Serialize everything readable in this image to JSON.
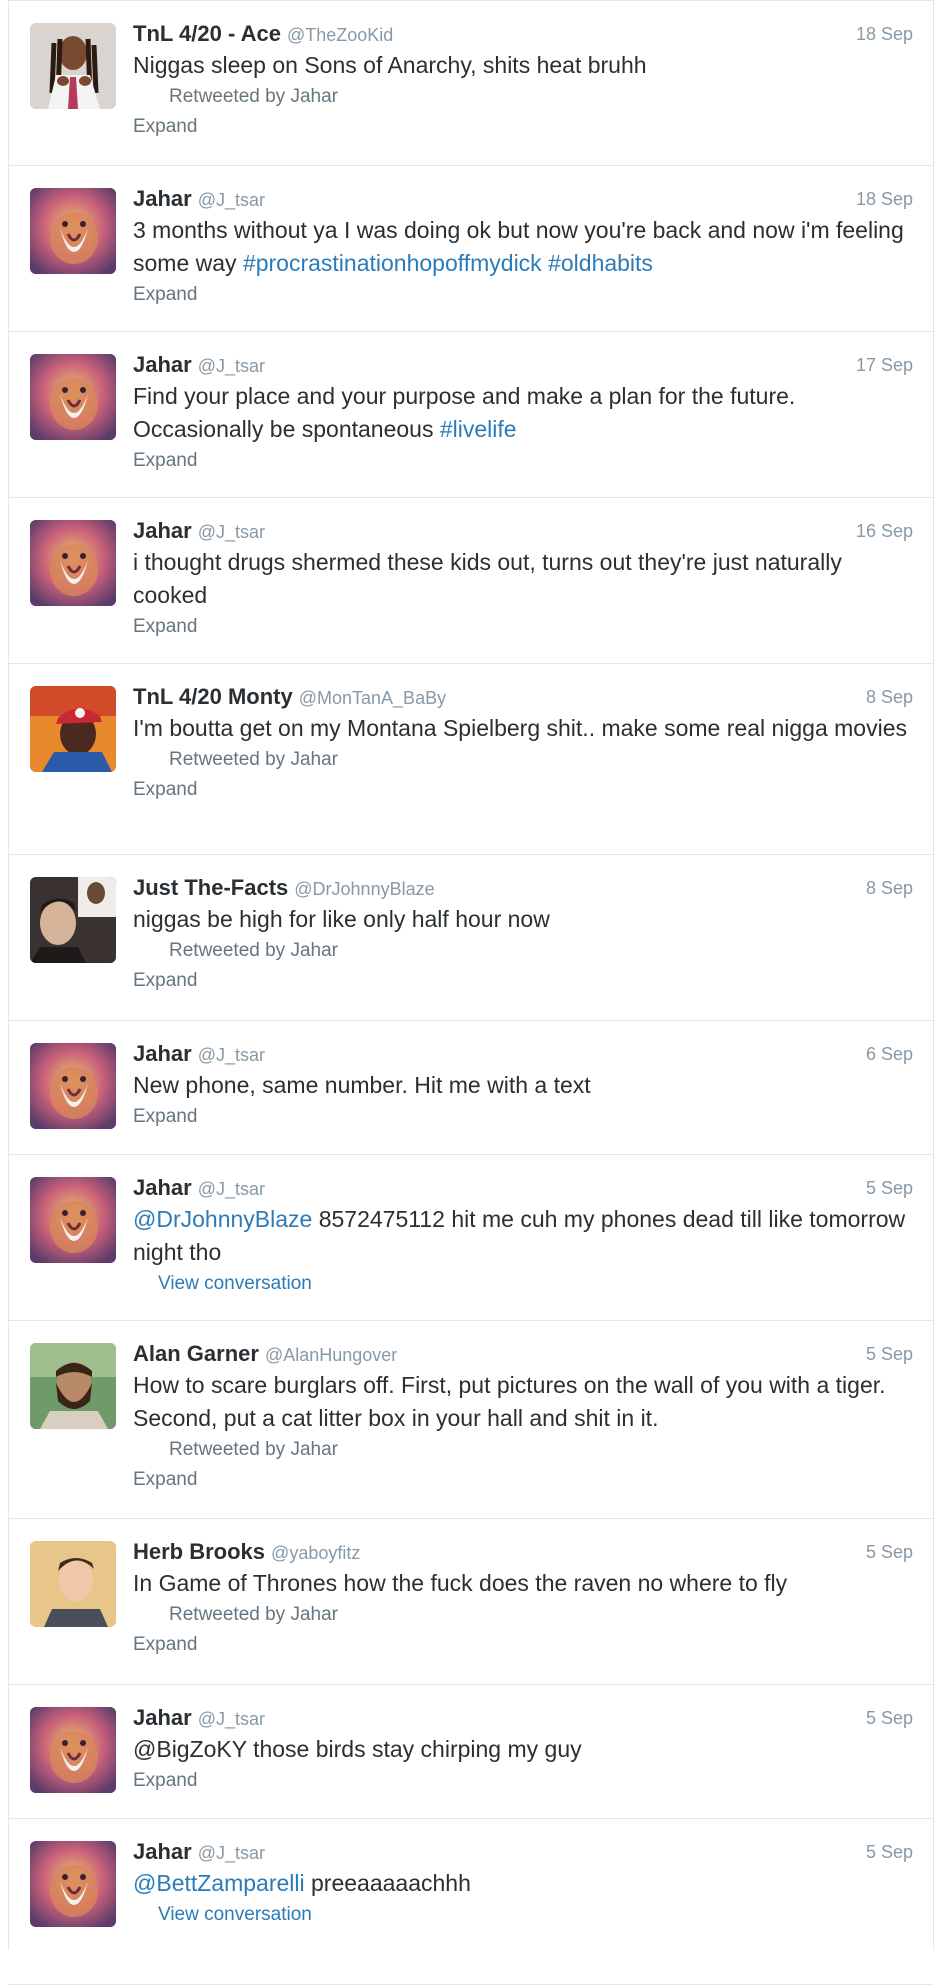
{
  "tweets": [
    {
      "name": "TnL 4/20 - Ace",
      "handle": "@TheZooKid",
      "time": "18 Sep",
      "parts": [
        {
          "t": "Niggas sleep on Sons of Anarchy, shits heat bruhh"
        }
      ],
      "retweeted_by": "Retweeted by Jahar",
      "action": "Expand",
      "avatar": "dreads-person"
    },
    {
      "name": "Jahar",
      "handle": "@J_tsar",
      "time": "18 Sep",
      "parts": [
        {
          "t": "3 months without ya I was doing ok but now you're back and now i'm feeling some way "
        },
        {
          "t": "#procrastinationhopoffmydick",
          "link": true
        },
        {
          "t": " "
        },
        {
          "t": "#oldhabits",
          "link": true
        }
      ],
      "retweeted_by": "",
      "action": "Expand",
      "avatar": "lion"
    },
    {
      "name": "Jahar",
      "handle": "@J_tsar",
      "time": "17 Sep",
      "parts": [
        {
          "t": "Find your place and your purpose and make a plan for the future. Occasionally be spontaneous "
        },
        {
          "t": "#livelife",
          "link": true
        }
      ],
      "retweeted_by": "",
      "action": "Expand",
      "avatar": "lion"
    },
    {
      "name": "Jahar",
      "handle": "@J_tsar",
      "time": "16 Sep",
      "parts": [
        {
          "t": "i thought drugs shermed these kids out, turns out they're just naturally cooked"
        }
      ],
      "retweeted_by": "",
      "action": "Expand",
      "avatar": "lion"
    },
    {
      "name": "TnL 4/20 Monty",
      "handle": "@MonTanA_BaBy",
      "time": "8 Sep",
      "parts": [
        {
          "t": "I'm boutta get on my Montana Spielberg shit.. make some real nigga movies"
        }
      ],
      "retweeted_by": "Retweeted by Jahar",
      "action": "Expand",
      "avatar": "cap-person"
    },
    {
      "name": "Just The-Facts",
      "handle": "@DrJohnnyBlaze",
      "time": "8 Sep",
      "parts": [
        {
          "t": "niggas be high for like only half hour now"
        }
      ],
      "retweeted_by": "Retweeted by Jahar",
      "action": "Expand",
      "avatar": "dark-person"
    },
    {
      "name": "Jahar",
      "handle": "@J_tsar",
      "time": "6 Sep",
      "parts": [
        {
          "t": "New phone, same number. Hit me with a text"
        }
      ],
      "retweeted_by": "",
      "action": "Expand",
      "avatar": "lion"
    },
    {
      "name": "Jahar",
      "handle": "@J_tsar",
      "time": "5 Sep",
      "parts": [
        {
          "t": "@DrJohnnyBlaze",
          "link": true
        },
        {
          "t": " 8572475112 hit me cuh my phones dead till like tomorrow night tho"
        }
      ],
      "retweeted_by": "",
      "action": "View conversation",
      "avatar": "lion"
    },
    {
      "name": "Alan Garner",
      "handle": "@AlanHungover",
      "time": "5 Sep",
      "parts": [
        {
          "t": "How to scare burglars off. First, put pictures on the wall of you with a tiger. Second, put a cat litter box in your hall and shit in it."
        }
      ],
      "retweeted_by": "Retweeted by Jahar",
      "action": "Expand",
      "avatar": "beard-person"
    },
    {
      "name": "Herb Brooks",
      "handle": "@yaboyfitz",
      "time": "5 Sep",
      "parts": [
        {
          "t": "In Game of Thrones how the fuck does the raven no where to fly"
        }
      ],
      "retweeted_by": "Retweeted by Jahar",
      "action": "Expand",
      "avatar": "young-person"
    },
    {
      "name": "Jahar",
      "handle": "@J_tsar",
      "time": "5 Sep",
      "parts": [
        {
          "t": "@BigZoKY those birds stay chirping my guy"
        }
      ],
      "retweeted_by": "",
      "action": "Expand",
      "avatar": "lion"
    },
    {
      "name": "Jahar",
      "handle": "@J_tsar",
      "time": "5 Sep",
      "parts": [
        {
          "t": "@BettZamparelli",
          "link": true
        },
        {
          "t": " preeaaaaachhh"
        }
      ],
      "retweeted_by": "",
      "action": "View conversation",
      "avatar": "lion"
    }
  ]
}
